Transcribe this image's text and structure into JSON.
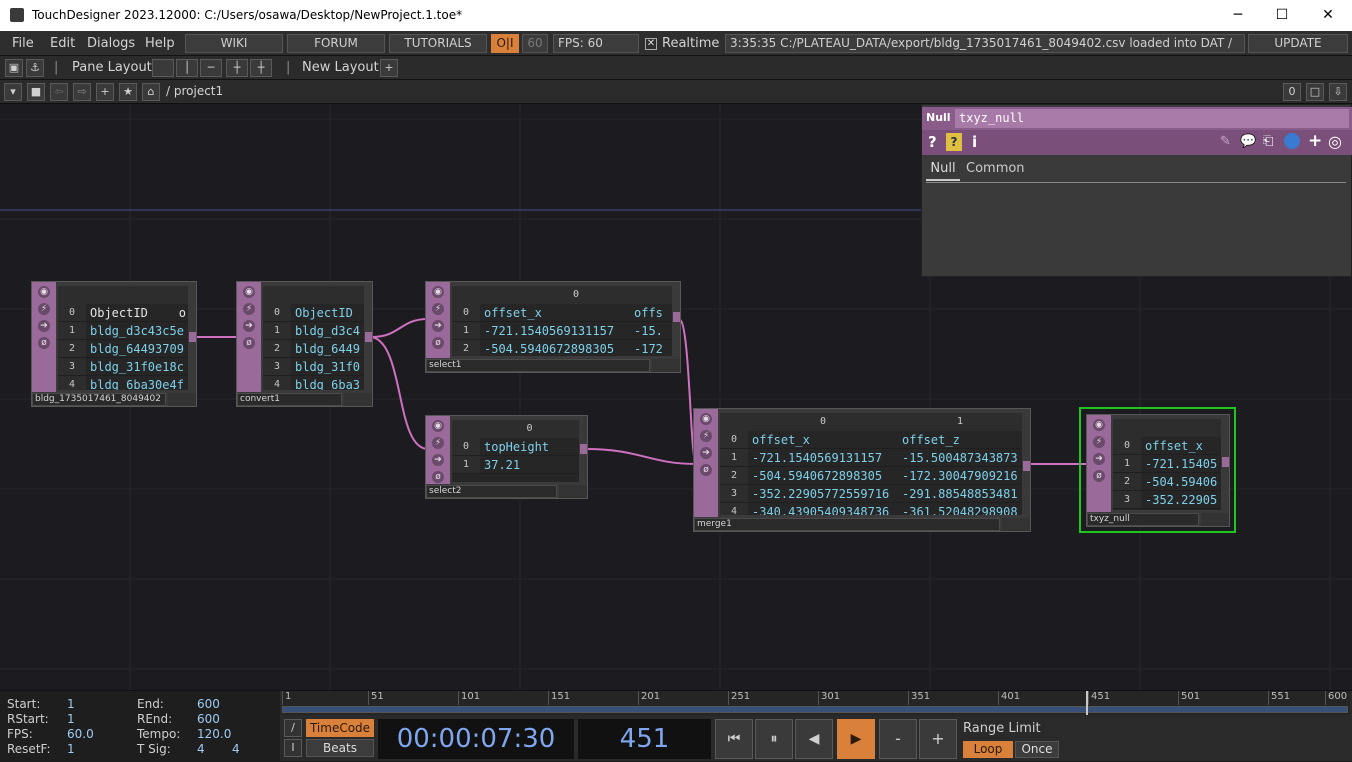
{
  "window": {
    "title": "TouchDesigner 2023.12000: C:/Users/osawa/Desktop/NewProject.1.toe*",
    "minimize": "─",
    "maximize": "☐",
    "close": "✕"
  },
  "menubar": {
    "file": "File",
    "edit": "Edit",
    "dialogs": "Dialogs",
    "help": "Help",
    "wiki": "WIKI",
    "forum": "FORUM",
    "tutorials": "TUTORIALS",
    "oi": "O|I",
    "fps_cap": "60",
    "fps_label": "FPS:",
    "fps_value": "60",
    "realtime_label": "Realtime",
    "status": "3:35:35 C:/PLATEAU_DATA/export/bldg_1735017461_8049402.csv loaded into DAT /",
    "update": "UPDATE"
  },
  "panebar": {
    "pane_layout": "Pane Layout",
    "new_layout": "New Layout",
    "plus": "+"
  },
  "pathbar": {
    "path": "/ project1",
    "counter": "0"
  },
  "nodes": {
    "csv": {
      "label": "bldg_1735017461_8049402",
      "header": "ObjectID",
      "header_extra": "o",
      "rows": [
        "bldg_d3c43c5e",
        "bldg_64493709",
        "bldg_31f0e18c",
        "bldg_6ba30e4f"
      ]
    },
    "convert1": {
      "label": "convert1",
      "header": "ObjectID",
      "rows": [
        "bldg_d3c4",
        "bldg_6449",
        "bldg_31f0",
        "bldg_6ba3"
      ]
    },
    "select1": {
      "label": "select1",
      "col0": "0",
      "header": "offset_x",
      "header2": "offs",
      "rows": [
        "-721.1540569131157",
        "-504.5940672898305"
      ],
      "rows2": [
        "-15.",
        "-172"
      ]
    },
    "select2": {
      "label": "select2",
      "col0": "0",
      "header": "topHeight",
      "rows": [
        "37.21"
      ]
    },
    "merge1": {
      "label": "merge1",
      "col0": "0",
      "col1": "1",
      "header_a": "offset_x",
      "header_b": "offset_z",
      "rows_a": [
        "-721.1540569131157",
        "-504.5940672898305",
        "-352.22905772559716",
        "-340.43905409348736"
      ],
      "rows_b": [
        "-15.500487343873",
        "-172.30047909216",
        "-291.88548853481",
        "-361.52048298908"
      ]
    },
    "txyz_null": {
      "label": "txyz_null",
      "header": "offset_x",
      "rows": [
        "-721.15405",
        "-504.59406",
        "-352.22905"
      ]
    }
  },
  "param_panel": {
    "type": "Null",
    "name": "txyz_null",
    "tab_null": "Null",
    "tab_common": "Common"
  },
  "timeline": {
    "start_label": "Start:",
    "start": "1",
    "end_label": "End:",
    "end": "600",
    "rstart_label": "RStart:",
    "rstart": "1",
    "rend_label": "REnd:",
    "rend": "600",
    "fps_label": "FPS:",
    "fps": "60.0",
    "tempo_label": "Tempo:",
    "tempo": "120.0",
    "resetf_label": "ResetF:",
    "resetf": "1",
    "tsig_label": "T Sig:",
    "tsig_a": "4",
    "tsig_b": "4",
    "ticks": [
      "1",
      "51",
      "101",
      "151",
      "201",
      "251",
      "301",
      "351",
      "401",
      "451",
      "501",
      "551",
      "600"
    ],
    "timecode_btn": "TimeCode",
    "beats_btn": "Beats",
    "timecode": "00:00:07:30",
    "frame": "451",
    "range_limit": "Range Limit",
    "loop": "Loop",
    "once": "Once",
    "minus": "-",
    "plus": "+"
  },
  "colors": {
    "accent": "#d9803a",
    "operator_dat": "#9a6a9a",
    "selected": "#1ec61e",
    "wire": "#d070c0"
  }
}
